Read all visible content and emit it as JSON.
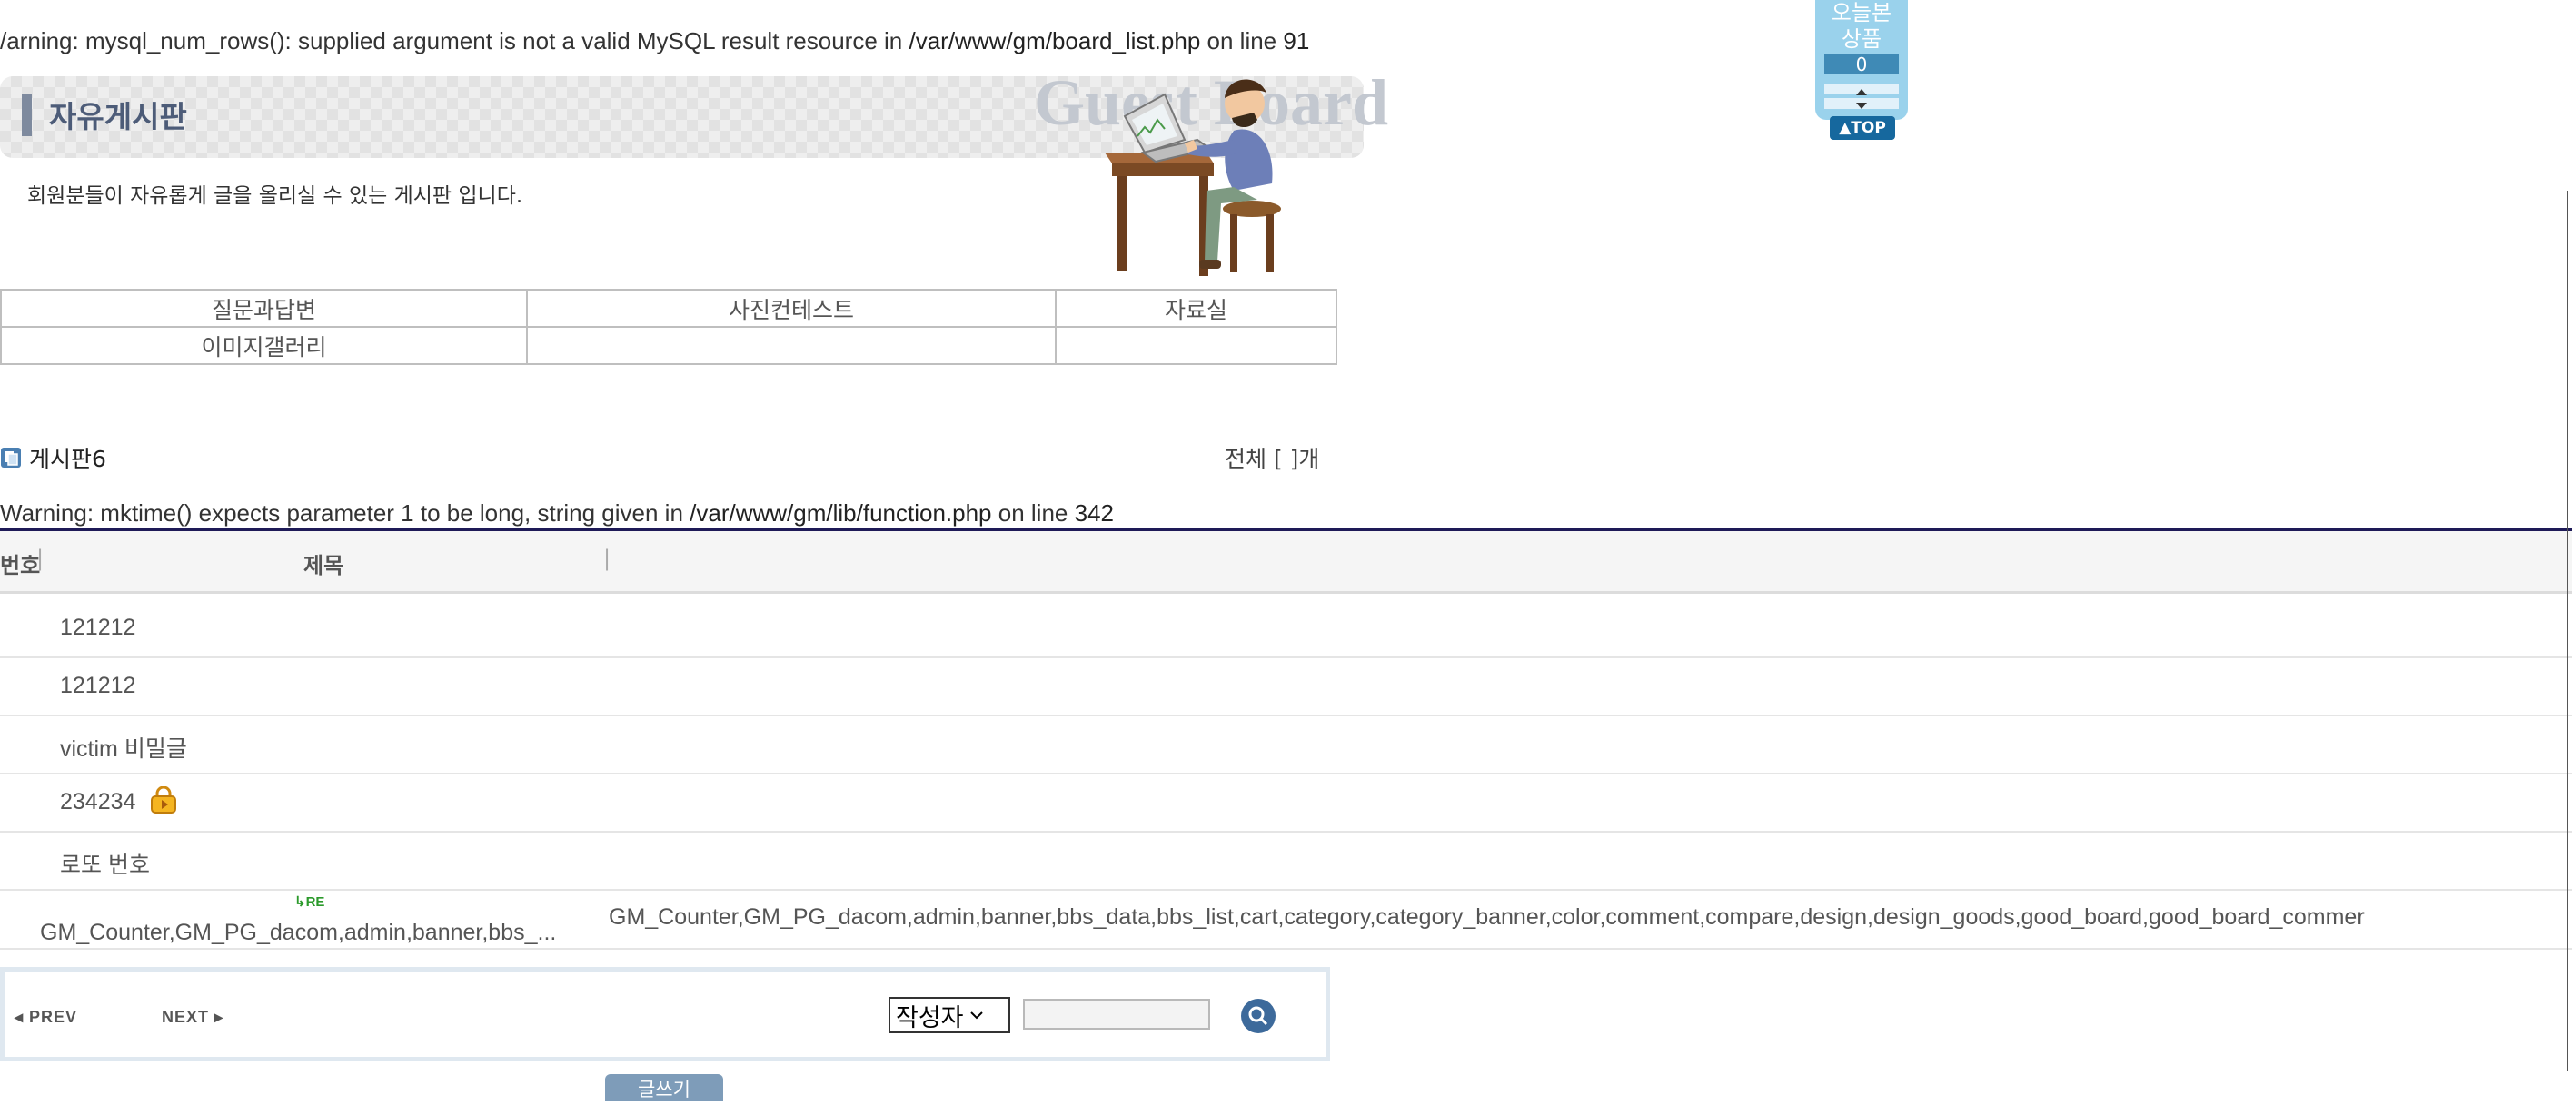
{
  "warnings": {
    "top": {
      "prefix": "/arning: ",
      "message": "mysql_num_rows(): supplied argument is not a valid MySQL result resource in ",
      "file": "/var/www/gm/board_list.php",
      "on_line": " on line ",
      "line": "91"
    },
    "middle": {
      "prefix": "Warning: ",
      "message": "mktime() expects parameter 1 to be long, string given in ",
      "file": "/var/www/gm/lib/function.php",
      "on_line": " on line ",
      "line": "342"
    }
  },
  "board_header": {
    "title": "자유게시판",
    "watermark": "Guest Board",
    "description": "회원분들이 자유롭게 글을 올리실 수 있는 게시판 입니다."
  },
  "categories": {
    "row1": [
      "질문과답변",
      "사진컨테스트",
      "자료실"
    ],
    "row2": [
      "이미지갤러리",
      "",
      ""
    ]
  },
  "section": {
    "title": "게시판6",
    "total": "전체 [ ]개"
  },
  "list": {
    "columns": {
      "number": "번호",
      "subject": "제목",
      "sep": "|"
    },
    "rows": [
      {
        "subject": "121212"
      },
      {
        "subject": "121212"
      },
      {
        "subject": "victim 비밀글"
      },
      {
        "subject": "234234"
      },
      {
        "subject": "로또 번호"
      }
    ],
    "reply_row": {
      "badge": "RE",
      "subject_truncated": "GM_Counter,GM_PG_dacom,admin,banner,bbs_...",
      "subject_full": "GM_Counter,GM_PG_dacom,admin,banner,bbs_data,bbs_list,cart,category,category_banner,color,comment,compare,design,design_goods,good_board,good_board_commer"
    }
  },
  "pager": {
    "prev": "◂ PREV",
    "next": "NEXT ▸",
    "search_select": "작성자",
    "search_value": ""
  },
  "write_button": "글쓰기",
  "side_widget": {
    "title_line1": "오늘본",
    "title_line2": "상품",
    "count": "0",
    "top_label": "▲TOP"
  },
  "colors": {
    "header_title": "#4d5c78",
    "list_top_line": "#1e1a57",
    "side_widget": "#9ad2ec",
    "search_button": "#3d6a9b"
  }
}
